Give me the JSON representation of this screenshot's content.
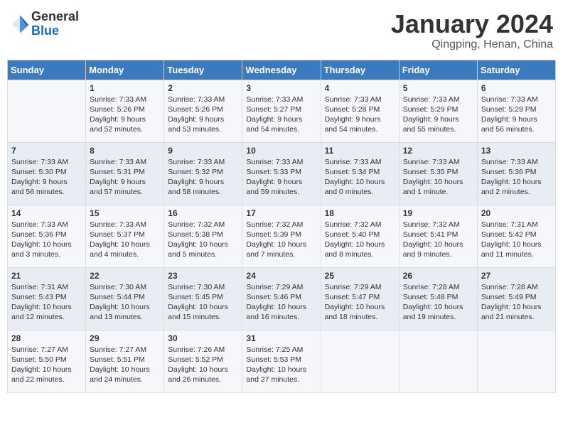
{
  "header": {
    "logo_general": "General",
    "logo_blue": "Blue",
    "month": "January 2024",
    "location": "Qingping, Henan, China"
  },
  "weekdays": [
    "Sunday",
    "Monday",
    "Tuesday",
    "Wednesday",
    "Thursday",
    "Friday",
    "Saturday"
  ],
  "weeks": [
    [
      {
        "day": "",
        "info": ""
      },
      {
        "day": "1",
        "info": "Sunrise: 7:33 AM\nSunset: 5:26 PM\nDaylight: 9 hours\nand 52 minutes."
      },
      {
        "day": "2",
        "info": "Sunrise: 7:33 AM\nSunset: 5:26 PM\nDaylight: 9 hours\nand 53 minutes."
      },
      {
        "day": "3",
        "info": "Sunrise: 7:33 AM\nSunset: 5:27 PM\nDaylight: 9 hours\nand 54 minutes."
      },
      {
        "day": "4",
        "info": "Sunrise: 7:33 AM\nSunset: 5:28 PM\nDaylight: 9 hours\nand 54 minutes."
      },
      {
        "day": "5",
        "info": "Sunrise: 7:33 AM\nSunset: 5:29 PM\nDaylight: 9 hours\nand 55 minutes."
      },
      {
        "day": "6",
        "info": "Sunrise: 7:33 AM\nSunset: 5:29 PM\nDaylight: 9 hours\nand 56 minutes."
      }
    ],
    [
      {
        "day": "7",
        "info": "Sunrise: 7:33 AM\nSunset: 5:30 PM\nDaylight: 9 hours\nand 56 minutes."
      },
      {
        "day": "8",
        "info": "Sunrise: 7:33 AM\nSunset: 5:31 PM\nDaylight: 9 hours\nand 57 minutes."
      },
      {
        "day": "9",
        "info": "Sunrise: 7:33 AM\nSunset: 5:32 PM\nDaylight: 9 hours\nand 58 minutes."
      },
      {
        "day": "10",
        "info": "Sunrise: 7:33 AM\nSunset: 5:33 PM\nDaylight: 9 hours\nand 59 minutes."
      },
      {
        "day": "11",
        "info": "Sunrise: 7:33 AM\nSunset: 5:34 PM\nDaylight: 10 hours\nand 0 minutes."
      },
      {
        "day": "12",
        "info": "Sunrise: 7:33 AM\nSunset: 5:35 PM\nDaylight: 10 hours\nand 1 minute."
      },
      {
        "day": "13",
        "info": "Sunrise: 7:33 AM\nSunset: 5:36 PM\nDaylight: 10 hours\nand 2 minutes."
      }
    ],
    [
      {
        "day": "14",
        "info": "Sunrise: 7:33 AM\nSunset: 5:36 PM\nDaylight: 10 hours\nand 3 minutes."
      },
      {
        "day": "15",
        "info": "Sunrise: 7:33 AM\nSunset: 5:37 PM\nDaylight: 10 hours\nand 4 minutes."
      },
      {
        "day": "16",
        "info": "Sunrise: 7:32 AM\nSunset: 5:38 PM\nDaylight: 10 hours\nand 5 minutes."
      },
      {
        "day": "17",
        "info": "Sunrise: 7:32 AM\nSunset: 5:39 PM\nDaylight: 10 hours\nand 7 minutes."
      },
      {
        "day": "18",
        "info": "Sunrise: 7:32 AM\nSunset: 5:40 PM\nDaylight: 10 hours\nand 8 minutes."
      },
      {
        "day": "19",
        "info": "Sunrise: 7:32 AM\nSunset: 5:41 PM\nDaylight: 10 hours\nand 9 minutes."
      },
      {
        "day": "20",
        "info": "Sunrise: 7:31 AM\nSunset: 5:42 PM\nDaylight: 10 hours\nand 11 minutes."
      }
    ],
    [
      {
        "day": "21",
        "info": "Sunrise: 7:31 AM\nSunset: 5:43 PM\nDaylight: 10 hours\nand 12 minutes."
      },
      {
        "day": "22",
        "info": "Sunrise: 7:30 AM\nSunset: 5:44 PM\nDaylight: 10 hours\nand 13 minutes."
      },
      {
        "day": "23",
        "info": "Sunrise: 7:30 AM\nSunset: 5:45 PM\nDaylight: 10 hours\nand 15 minutes."
      },
      {
        "day": "24",
        "info": "Sunrise: 7:29 AM\nSunset: 5:46 PM\nDaylight: 10 hours\nand 16 minutes."
      },
      {
        "day": "25",
        "info": "Sunrise: 7:29 AM\nSunset: 5:47 PM\nDaylight: 10 hours\nand 18 minutes."
      },
      {
        "day": "26",
        "info": "Sunrise: 7:28 AM\nSunset: 5:48 PM\nDaylight: 10 hours\nand 19 minutes."
      },
      {
        "day": "27",
        "info": "Sunrise: 7:28 AM\nSunset: 5:49 PM\nDaylight: 10 hours\nand 21 minutes."
      }
    ],
    [
      {
        "day": "28",
        "info": "Sunrise: 7:27 AM\nSunset: 5:50 PM\nDaylight: 10 hours\nand 22 minutes."
      },
      {
        "day": "29",
        "info": "Sunrise: 7:27 AM\nSunset: 5:51 PM\nDaylight: 10 hours\nand 24 minutes."
      },
      {
        "day": "30",
        "info": "Sunrise: 7:26 AM\nSunset: 5:52 PM\nDaylight: 10 hours\nand 26 minutes."
      },
      {
        "day": "31",
        "info": "Sunrise: 7:25 AM\nSunset: 5:53 PM\nDaylight: 10 hours\nand 27 minutes."
      },
      {
        "day": "",
        "info": ""
      },
      {
        "day": "",
        "info": ""
      },
      {
        "day": "",
        "info": ""
      }
    ]
  ]
}
